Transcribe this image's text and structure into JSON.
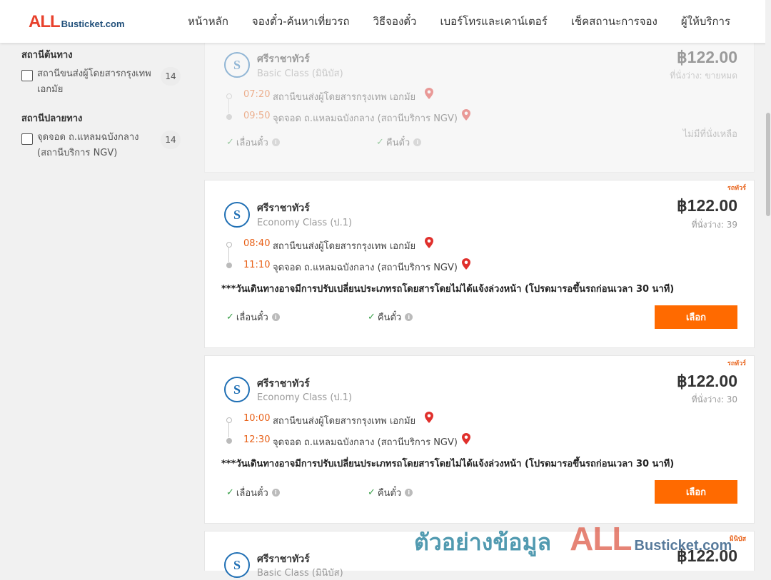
{
  "brand": {
    "logo_all": "ALL",
    "logo_rest": "Busticket.com"
  },
  "nav": [
    {
      "label": "หน้าหลัก"
    },
    {
      "label": "จองตั๋ว-ค้นหาเที่ยวรถ"
    },
    {
      "label": "วิธีจองตั๋ว"
    },
    {
      "label": "เบอร์โทรและเคาน์เตอร์"
    },
    {
      "label": "เช็คสถานะการจอง"
    },
    {
      "label": "ผู้ให้บริการ"
    }
  ],
  "sidebar": {
    "origin_title": "สถานีต้นทาง",
    "origin_filter": {
      "label": "สถานีขนส่งผู้โดยสารกรุงเทพ เอกมัย",
      "count": "14"
    },
    "dest_title": "สถานีปลายทาง",
    "dest_filter": {
      "label": "จุดจอด ถ.แหลมฉบังกลาง (สถานีบริการ NGV)",
      "count": "14"
    }
  },
  "trips": [
    {
      "operator": "ศรีราชาทัวร์",
      "class": "Basic Class (มินิบัส)",
      "price": "฿122.00",
      "seats": "ที่นั่งว่าง: ขายหมด",
      "depart_time": "07:20",
      "depart_station": "สถานีขนส่งผู้โดยสารกรุงเทพ เอกมัย",
      "arrive_time": "09:50",
      "arrive_station": "จุดจอด ถ.แหลมฉบังกลาง (สถานีบริการ NGV)",
      "feature_1": "เลื่อนตั๋ว",
      "feature_2": "คืนตั๋ว",
      "status": "ไม่มีที่นั่งเหลือ"
    },
    {
      "badge": "รถทัวร์",
      "operator": "ศรีราชาทัวร์",
      "class": "Economy Class (ป.1)",
      "price": "฿122.00",
      "seats": "ที่นั่งว่าง: 39",
      "depart_time": "08:40",
      "depart_station": "สถานีขนส่งผู้โดยสารกรุงเทพ เอกมัย",
      "arrive_time": "11:10",
      "arrive_station": "จุดจอด ถ.แหลมฉบังกลาง (สถานีบริการ NGV)",
      "notice": "***วันเดินทางอาจมีการปรับเปลี่ยนประเภทรถโดยสารโดยไม่ได้แจ้งล่วงหน้า (โปรดมารอขึ้นรถก่อนเวลา 30 นาที)",
      "feature_1": "เลื่อนตั๋ว",
      "feature_2": "คืนตั๋ว",
      "button": "เลือก"
    },
    {
      "badge": "รถทัวร์",
      "operator": "ศรีราชาทัวร์",
      "class": "Economy Class (ป.1)",
      "price": "฿122.00",
      "seats": "ที่นั่งว่าง: 30",
      "depart_time": "10:00",
      "depart_station": "สถานีขนส่งผู้โดยสารกรุงเทพ เอกมัย",
      "arrive_time": "12:30",
      "arrive_station": "จุดจอด ถ.แหลมฉบังกลาง (สถานีบริการ NGV)",
      "notice": "***วันเดินทางอาจมีการปรับเปลี่ยนประเภทรถโดยสารโดยไม่ได้แจ้งล่วงหน้า (โปรดมารอขึ้นรถก่อนเวลา 30 นาที)",
      "feature_1": "เลื่อนตั๋ว",
      "feature_2": "คืนตั๋ว",
      "button": "เลือก"
    },
    {
      "badge": "มินิบัส",
      "operator": "ศรีราชาทัวร์",
      "class": "Basic Class (มินิบัส)",
      "price": "฿122.00"
    }
  ],
  "watermark": {
    "text": "ตัวอย่างข้อมูล",
    "logo_all": "ALL",
    "logo_rest": "Busticket.com"
  },
  "colors": {
    "accent": "#ff6a00",
    "time": "#e8621a",
    "check": "#3aa04a",
    "pin": "#e0302c"
  }
}
